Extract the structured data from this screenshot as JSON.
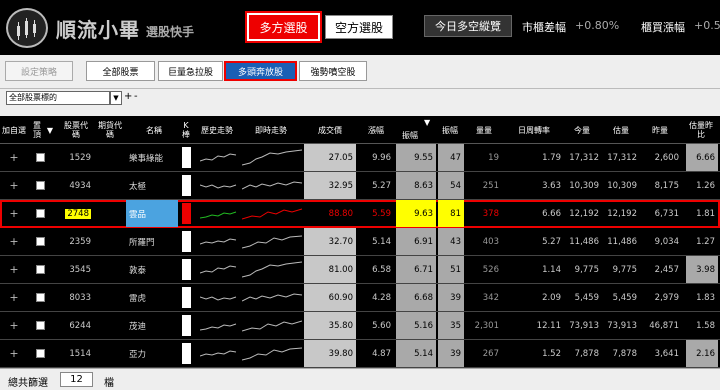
{
  "header": {
    "logo_text": "順流小畢",
    "logo_sub": "選股快手",
    "long_button": "多方選股",
    "short_button": "空方選股",
    "today_button": "今日多空縱覽",
    "market_spread_label": "市櫃差幅",
    "market_spread_value": "+0.80%",
    "otc_change_label": "櫃買漲幅",
    "otc_change_value": "+0.5"
  },
  "toolbar": {
    "set_strategy": "設定策略",
    "all_stocks": "全部股票",
    "surge": "巨量急拉股",
    "bull_run": "多頭奔放股",
    "strong_short": "強勢噴空股"
  },
  "filter": {
    "selected": "全部股票標的",
    "arrow": "▼",
    "plus": "+",
    "minus": "-"
  },
  "columns": {
    "add": "加自選",
    "pin": "置頂",
    "pin_sort": "▼",
    "code": "股票代碼",
    "futures": "期貨代碼",
    "name": "名稱",
    "kbar": "K棒",
    "trend": "歷史走勢",
    "intraday": "即時走勢",
    "price": "成交價",
    "change_pct": "漲幅",
    "amplitude": "振幅",
    "amp_sort": "▼",
    "amp_rank": "振幅",
    "volume": "量量",
    "weekly_turnover": "日周轉率",
    "today_vol": "今量",
    "est_vol": "估量",
    "yest_vol": "昨量",
    "est_ratio": "估量昨比"
  },
  "rows": [
    {
      "plus": "+",
      "code": "1529",
      "name": "樂事綠能",
      "price": "27.05",
      "change": "9.96",
      "amp": "9.55",
      "rank": "47",
      "vol": "19",
      "turnover": "1.79",
      "today": "17,312",
      "est": "17,312",
      "yest": "2,600",
      "ratio": "6.66"
    },
    {
      "plus": "+",
      "code": "4934",
      "name": "太極",
      "price": "32.95",
      "change": "5.27",
      "amp": "8.63",
      "rank": "54",
      "vol": "251",
      "turnover": "3.63",
      "today": "10,309",
      "est": "10,309",
      "yest": "8,175",
      "ratio": "1.26"
    },
    {
      "plus": "+",
      "code": "2748",
      "name": "雲品",
      "price": "88.80",
      "change": "5.59",
      "amp": "9.63",
      "rank": "81",
      "vol": "378",
      "turnover": "6.66",
      "today": "12,192",
      "est": "12,192",
      "yest": "6,731",
      "ratio": "1.81"
    },
    {
      "plus": "+",
      "code": "2359",
      "name": "所羅門",
      "price": "32.70",
      "change": "5.14",
      "amp": "6.91",
      "rank": "43",
      "vol": "403",
      "turnover": "5.27",
      "today": "11,486",
      "est": "11,486",
      "yest": "9,034",
      "ratio": "1.27"
    },
    {
      "plus": "+",
      "code": "3545",
      "name": "敦泰",
      "price": "81.00",
      "change": "6.58",
      "amp": "6.71",
      "rank": "51",
      "vol": "526",
      "turnover": "1.14",
      "today": "9,775",
      "est": "9,775",
      "yest": "2,457",
      "ratio": "3.98"
    },
    {
      "plus": "+",
      "code": "8033",
      "name": "雷虎",
      "price": "60.90",
      "change": "4.28",
      "amp": "6.68",
      "rank": "39",
      "vol": "342",
      "turnover": "2.09",
      "today": "5,459",
      "est": "5,459",
      "yest": "2,979",
      "ratio": "1.83"
    },
    {
      "plus": "+",
      "code": "6244",
      "name": "茂迪",
      "price": "35.80",
      "change": "5.60",
      "amp": "5.16",
      "rank": "35",
      "vol": "2,301",
      "turnover": "12.11",
      "today": "73,913",
      "est": "73,913",
      "yest": "46,871",
      "ratio": "1.58"
    },
    {
      "plus": "+",
      "code": "1514",
      "name": "亞力",
      "price": "39.80",
      "change": "4.87",
      "amp": "5.14",
      "rank": "39",
      "vol": "267",
      "turnover": "1.52",
      "today": "7,878",
      "est": "7,878",
      "yest": "3,641",
      "ratio": "2.16"
    }
  ],
  "footer": {
    "label": "總共篩選",
    "count": "12",
    "unit": "檔"
  },
  "colors": {
    "red": "#ee0000",
    "yellow": "#ffff00",
    "blue": "#1a5fb4",
    "gray": "#c8c8c8"
  }
}
